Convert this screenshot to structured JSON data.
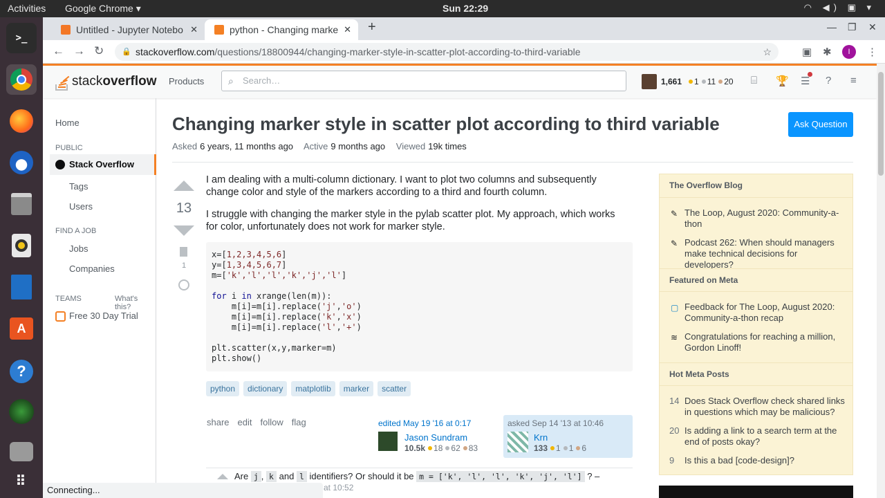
{
  "os": {
    "activities": "Activities",
    "app_menu": "Google Chrome ▾",
    "clock": "Sun 22:29"
  },
  "browser": {
    "tabs": [
      {
        "label": "Untitled - Jupyter Notebo",
        "close": "✕"
      },
      {
        "label": "python - Changing marke",
        "close": "✕"
      }
    ],
    "new_tab": "+",
    "url_host": "stackoverflow.com",
    "url_path": "/questions/18800944/changing-marker-style-in-scatter-plot-according-to-third-variable",
    "profile_initial": "I"
  },
  "so": {
    "logo_a": "stack",
    "logo_b": "overflow",
    "products": "Products",
    "search_placeholder": "Search…",
    "rep": "1,661",
    "gold": "1",
    "silver": "11",
    "bronze": "20"
  },
  "nav": {
    "home": "Home",
    "public": "PUBLIC",
    "so": "Stack Overflow",
    "tags": "Tags",
    "users": "Users",
    "find_job": "FIND A JOB",
    "jobs": "Jobs",
    "companies": "Companies",
    "teams": "TEAMS",
    "whats_this": "What's this?",
    "trial": "Free 30 Day Trial"
  },
  "question": {
    "title": "Changing marker style in scatter plot according to third variable",
    "ask_button": "Ask Question",
    "asked_label": "Asked",
    "asked_val": "6 years, 11 months ago",
    "active_label": "Active",
    "active_val": "9 months ago",
    "viewed_label": "Viewed",
    "viewed_val": "19k times",
    "score": "13",
    "bookmarks": "1",
    "p1": "I am dealing with a multi-column dictionary. I want to plot two columns and subsequently change color and style of the markers according to a third and fourth column.",
    "p2": "I struggle with changing the marker style in the pylab scatter plot. My approach, which works for color, unfortunately does not work for marker style.",
    "tags": [
      "python",
      "dictionary",
      "matplotlib",
      "marker",
      "scatter"
    ],
    "actions": [
      "share",
      "edit",
      "follow",
      "flag"
    ],
    "edited": "edited May 19 '16 at 0:17",
    "editor": "Jason Sundram",
    "editor_rep": "10.5k",
    "editor_gold": "18",
    "editor_silver": "62",
    "editor_bronze": "83",
    "asked_at": "asked Sep 14 '13 at 10:46",
    "asker": "Krn",
    "asker_rep": "133",
    "asker_gold": "1",
    "asker_silver": "1",
    "asker_bronze": "6"
  },
  "comment": {
    "c1": "Are",
    "j": "j",
    "sep1": ",",
    "k": "k",
    "and": "and",
    "l": "l",
    "c2": "identifiers? Or should it be",
    "code": "m = ['k', 'l', 'l', 'k', 'j', 'l']",
    "c3": "? –",
    "time": "at 10:52"
  },
  "sidebar": {
    "blog_title": "The Overflow Blog",
    "blog": [
      "The Loop, August 2020: Community-a-thon",
      "Podcast 262: When should managers make technical decisions for developers?"
    ],
    "meta_title": "Featured on Meta",
    "meta": [
      "Feedback for The Loop, August 2020: Community-a-thon recap",
      "Congratulations for reaching a million, Gordon Linoff!"
    ],
    "hot_title": "Hot Meta Posts",
    "hot": [
      {
        "n": "14",
        "t": "Does Stack Overflow check shared links in questions which may be malicious?"
      },
      {
        "n": "20",
        "t": "Is adding a link to a search term at the end of posts okay?"
      },
      {
        "n": "9",
        "t": "Is this a bad [code-design]?"
      }
    ]
  },
  "status": "Connecting..."
}
